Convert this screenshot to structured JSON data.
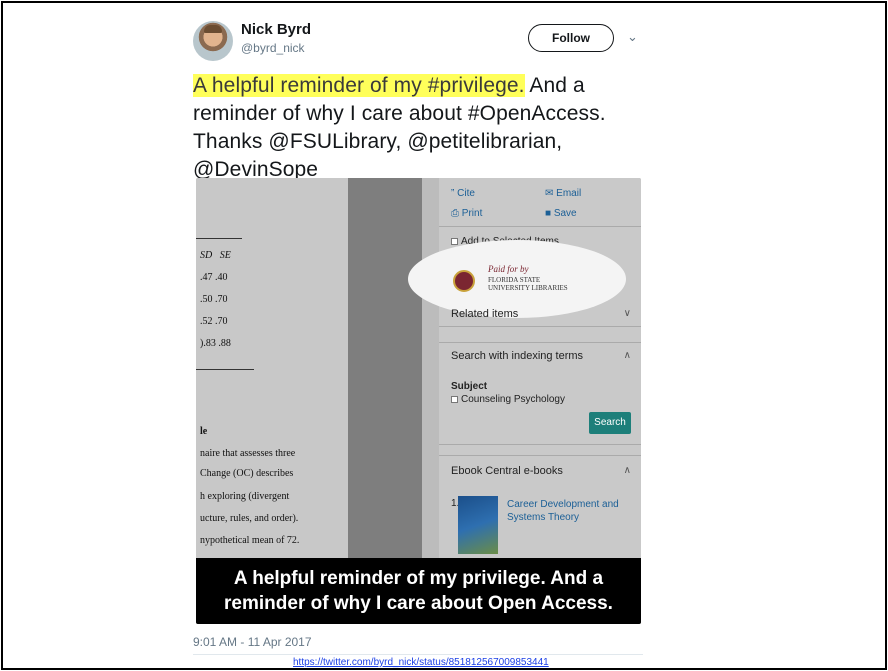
{
  "tweet": {
    "name": "Nick Byrd",
    "handle": "@byrd_nick",
    "follow_label": "Follow",
    "highlight_text": "A helpful reminder of my #privilege.",
    "body_rest": " And a reminder of why I care about #OpenAccess. Thanks @FSULibrary, @petitelibrarian, @DevinSope",
    "timestamp": "9:01 AM - 11 Apr 2017"
  },
  "media": {
    "paper_lines": {
      "col_sd": "SD",
      "col_se": "SE",
      "row1": ".47  .40",
      "row2": ".50  .70",
      "row3": ".52  .70",
      "row4": ").83  .88",
      "heading": "le",
      "text1": "naire that assesses three",
      "text2": "Change (OC) describes",
      "text3": "h exploring (divergent",
      "text4": "ucture, rules, and order).",
      "text5": "nypothetical mean of 72."
    },
    "sidebar": {
      "cite": "Cite",
      "email": "Email",
      "print": "Print",
      "save": "Save",
      "add_selected": "Add to Selected Items",
      "paid_for_by": "Paid for by",
      "fsu_line1": "FLORIDA STATE",
      "fsu_line2": "UNIVERSITY LIBRARIES",
      "related_items": "Related items",
      "search_indexing": "Search with indexing terms",
      "subject_label": "Subject",
      "subject_item": "Counseling Psychology",
      "search_button": "Search",
      "ebook_central": "Ebook Central e-books",
      "book_number": "1.",
      "book_title": "Career Development and Systems Theory"
    },
    "caption": "A helpful reminder of my privilege. And a reminder of why I care about Open Access."
  },
  "source_url": "https://twitter.com/byrd_nick/status/851812567009853441",
  "colors": {
    "highlight": "#ffff5a",
    "link": "#1b5f96",
    "search_button": "#1d7f7a",
    "url": "#1a3ee6"
  }
}
